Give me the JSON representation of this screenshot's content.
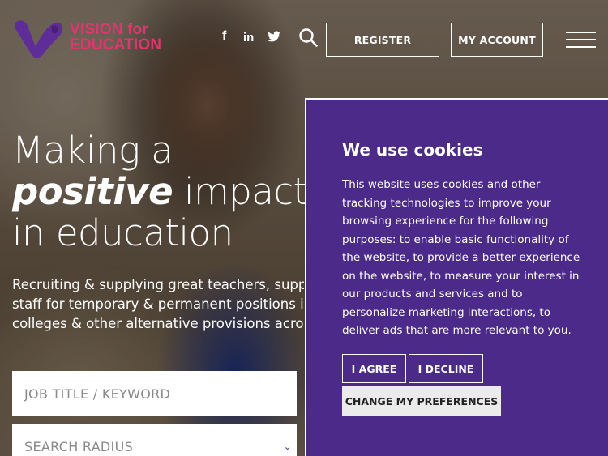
{
  "header": {
    "logo": {
      "line1": "VISION for",
      "line2": "EDUCATION"
    },
    "social": [
      {
        "icon": "facebook-icon",
        "glyph": "f"
      },
      {
        "icon": "linkedin-icon",
        "glyph": "in"
      },
      {
        "icon": "twitter-icon",
        "glyph": "t"
      }
    ],
    "register_label": "REGISTER",
    "account_label": "MY ACCOUNT"
  },
  "hero": {
    "headline": {
      "line1": "Making a",
      "line2_bold": "positive",
      "line2_rest": " impact",
      "line3": "in education"
    },
    "subtext": [
      "Recruiting & supplying great teachers, support",
      "staff for temporary & permanent positions in",
      "colleges & other alternative provisions across"
    ],
    "job_field_placeholder": "JOB TITLE / KEYWORD",
    "radius_field_placeholder": "SEARCH RADIUS"
  },
  "cookie": {
    "title": "We use cookies",
    "body": "This website uses cookies and other tracking technologies to improve your browsing experience for the following purposes: to enable basic functionality of the website, to provide a better experience on the website, to measure your interest in our products and services and to personalize marketing interactions, to deliver ads that are more relevant to you.",
    "agree_label": "I AGREE",
    "decline_label": "I DECLINE",
    "prefs_label": "CHANGE MY PREFERENCES"
  },
  "colors": {
    "brand_pink": "#e0356e",
    "brand_purple": "#4b2a8a"
  }
}
